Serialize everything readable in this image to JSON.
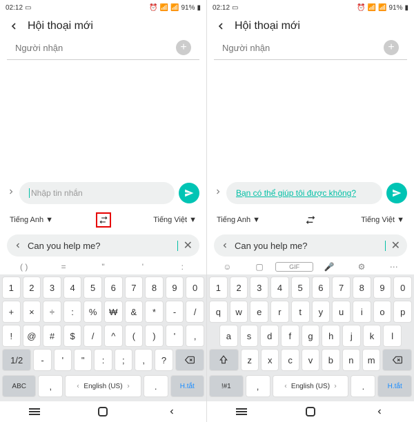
{
  "status": {
    "time": "02:12",
    "battery": "91%"
  },
  "header": {
    "title": "Hội thoại mới"
  },
  "recipient": {
    "placeholder": "Người nhận"
  },
  "message": {
    "placeholder": "Nhập tin nhắn",
    "translated": "Bạn có thể giúp tôi được không?"
  },
  "lang": {
    "from": "Tiếng Anh",
    "to": "Tiếng Việt"
  },
  "translate": {
    "text": "Can you help me?"
  },
  "toolbar_left": [
    "( )",
    "=",
    "\"",
    "'",
    ":"
  ],
  "keyboard_left": {
    "row1": [
      "1",
      "2",
      "3",
      "4",
      "5",
      "6",
      "7",
      "8",
      "9",
      "0"
    ],
    "row2": [
      "+",
      "×",
      "÷",
      ":",
      "%",
      "₩",
      "&",
      "*",
      "-",
      "/"
    ],
    "row3": [
      "!",
      "@",
      "#",
      "$",
      "/",
      "^",
      "(",
      ")",
      "'",
      ","
    ],
    "row4_left": "1/2",
    "row4_keys": [
      "-",
      "'",
      "\"",
      ":",
      ";",
      ",",
      "?"
    ],
    "row5_left": "ABC",
    "row5_lang": "English (US)",
    "row5_right": "H.tắt"
  },
  "keyboard_right": {
    "row1": [
      "1",
      "2",
      "3",
      "4",
      "5",
      "6",
      "7",
      "8",
      "9",
      "0"
    ],
    "row2": [
      "q",
      "w",
      "e",
      "r",
      "t",
      "y",
      "u",
      "i",
      "o",
      "p"
    ],
    "row3": [
      "a",
      "s",
      "d",
      "f",
      "g",
      "h",
      "j",
      "k",
      "l"
    ],
    "row4_keys": [
      "z",
      "x",
      "c",
      "v",
      "b",
      "n",
      "m"
    ],
    "row5_left": "!#1",
    "row5_lang": "English (US)",
    "row5_right": "H.tắt"
  },
  "comma": ",",
  "period": "."
}
